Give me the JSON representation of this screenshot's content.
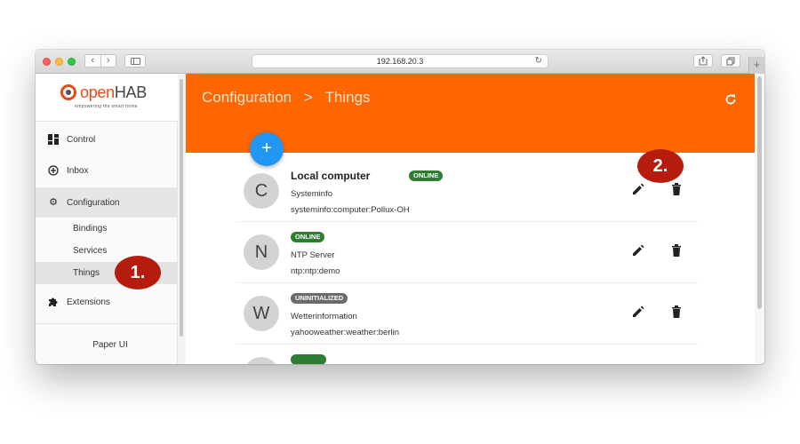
{
  "browser": {
    "url": "192.168.20.3",
    "reload_icon": "reload-icon",
    "back_glyph": "‹",
    "forward_glyph": "›",
    "new_tab_glyph": "+"
  },
  "sidebar": {
    "logo_word_1": "open",
    "logo_word_2": "HAB",
    "logo_tagline": "empowering the smart home",
    "items": [
      {
        "label": "Control",
        "icon": "dashboard-icon"
      },
      {
        "label": "Inbox",
        "icon": "add-circle-icon"
      },
      {
        "label": "Configuration",
        "icon": "gear-icon"
      },
      {
        "label": "Extensions",
        "icon": "puzzle-icon"
      }
    ],
    "subitems": [
      {
        "label": "Bindings"
      },
      {
        "label": "Services"
      },
      {
        "label": "Things"
      }
    ],
    "footer": "Paper UI"
  },
  "header": {
    "crumb_parent": "Configuration",
    "crumb_separator": ">",
    "crumb_current": "Things",
    "add_label": "+"
  },
  "things": [
    {
      "avatar": "C",
      "title": "Local computer",
      "status": "ONLINE",
      "binding": "Systeminfo",
      "uid": "systeminfo:computer:Pollux-OH"
    },
    {
      "avatar": "N",
      "title": "",
      "status": "ONLINE",
      "binding": "NTP Server",
      "uid": "ntp:ntp:demo"
    },
    {
      "avatar": "W",
      "title": "",
      "status": "UNINITIALIZED",
      "binding": "Wetterinformation",
      "uid": "yahooweather:weather:berlin"
    }
  ],
  "callouts": [
    "1.",
    "2."
  ],
  "colors": {
    "header": "#ff6600",
    "fab": "#2196f3",
    "online": "#2e7d32",
    "uninitialized": "#6b6b6b",
    "callout": "#b51c0e"
  }
}
